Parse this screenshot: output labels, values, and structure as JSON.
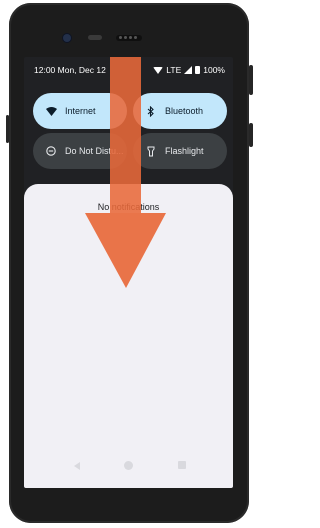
{
  "status_bar": {
    "time": "12:00 Mon, Dec 12",
    "network": "LTE",
    "battery": "100%"
  },
  "quick_settings": {
    "tiles": [
      {
        "label": "Internet",
        "icon": "wifi-icon",
        "state": "on"
      },
      {
        "label": "Bluetooth",
        "icon": "bluetooth-icon",
        "state": "on"
      },
      {
        "label": "Do Not Distu...",
        "icon": "do-not-disturb-icon",
        "state": "off"
      },
      {
        "label": "Flashlight",
        "icon": "flashlight-icon",
        "state": "off"
      }
    ]
  },
  "notifications": {
    "empty_message": "No notifications"
  },
  "navigation": {
    "icons": [
      "back-icon",
      "home-icon",
      "recents-icon"
    ]
  },
  "overlay": {
    "arrow_icon": "swipe-down-arrow-icon",
    "arrow_color": "#e8693a"
  },
  "colors": {
    "tile_on": "#c2e7fb",
    "tile_off": "#3c4043",
    "shade_bg": "#202124",
    "notification_bg": "#f1f0f5"
  }
}
